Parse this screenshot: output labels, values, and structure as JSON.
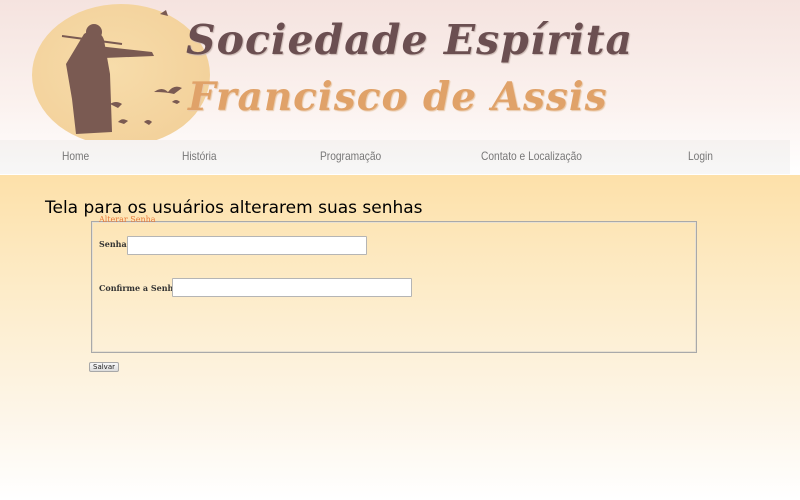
{
  "header": {
    "title_line1": "Sociedade Espírita",
    "title_line2": "Francisco de Assis",
    "logo": "saint-francis-with-birds-logo"
  },
  "nav": {
    "items": [
      {
        "label": "Home"
      },
      {
        "label": "História"
      },
      {
        "label": "Programação"
      },
      {
        "label": "Contato e Localização"
      },
      {
        "label": "Login"
      }
    ]
  },
  "page": {
    "heading": "Tela para os usuários alterarem suas senhas"
  },
  "form": {
    "legend": "Alterar Senha",
    "password_label": "Senha:",
    "password_value": "",
    "confirm_label": "Confirme a Senha:",
    "confirm_value": "",
    "save_label": "Salvar"
  },
  "colors": {
    "title_line1": "#6b4f51",
    "title_line2": "#e0a269",
    "legend": "#e87a3a",
    "nav_text": "#777777"
  }
}
